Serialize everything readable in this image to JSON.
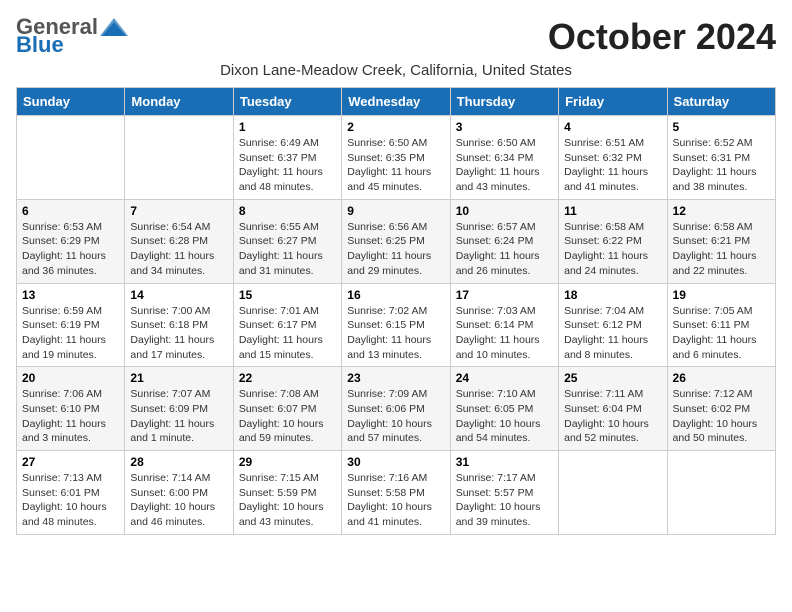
{
  "logo": {
    "general": "General",
    "blue": "Blue"
  },
  "title": "October 2024",
  "subtitle": "Dixon Lane-Meadow Creek, California, United States",
  "days_of_week": [
    "Sunday",
    "Monday",
    "Tuesday",
    "Wednesday",
    "Thursday",
    "Friday",
    "Saturday"
  ],
  "weeks": [
    [
      {
        "day": "",
        "info": ""
      },
      {
        "day": "",
        "info": ""
      },
      {
        "day": "1",
        "info": "Sunrise: 6:49 AM\nSunset: 6:37 PM\nDaylight: 11 hours\nand 48 minutes."
      },
      {
        "day": "2",
        "info": "Sunrise: 6:50 AM\nSunset: 6:35 PM\nDaylight: 11 hours\nand 45 minutes."
      },
      {
        "day": "3",
        "info": "Sunrise: 6:50 AM\nSunset: 6:34 PM\nDaylight: 11 hours\nand 43 minutes."
      },
      {
        "day": "4",
        "info": "Sunrise: 6:51 AM\nSunset: 6:32 PM\nDaylight: 11 hours\nand 41 minutes."
      },
      {
        "day": "5",
        "info": "Sunrise: 6:52 AM\nSunset: 6:31 PM\nDaylight: 11 hours\nand 38 minutes."
      }
    ],
    [
      {
        "day": "6",
        "info": "Sunrise: 6:53 AM\nSunset: 6:29 PM\nDaylight: 11 hours\nand 36 minutes."
      },
      {
        "day": "7",
        "info": "Sunrise: 6:54 AM\nSunset: 6:28 PM\nDaylight: 11 hours\nand 34 minutes."
      },
      {
        "day": "8",
        "info": "Sunrise: 6:55 AM\nSunset: 6:27 PM\nDaylight: 11 hours\nand 31 minutes."
      },
      {
        "day": "9",
        "info": "Sunrise: 6:56 AM\nSunset: 6:25 PM\nDaylight: 11 hours\nand 29 minutes."
      },
      {
        "day": "10",
        "info": "Sunrise: 6:57 AM\nSunset: 6:24 PM\nDaylight: 11 hours\nand 26 minutes."
      },
      {
        "day": "11",
        "info": "Sunrise: 6:58 AM\nSunset: 6:22 PM\nDaylight: 11 hours\nand 24 minutes."
      },
      {
        "day": "12",
        "info": "Sunrise: 6:58 AM\nSunset: 6:21 PM\nDaylight: 11 hours\nand 22 minutes."
      }
    ],
    [
      {
        "day": "13",
        "info": "Sunrise: 6:59 AM\nSunset: 6:19 PM\nDaylight: 11 hours\nand 19 minutes."
      },
      {
        "day": "14",
        "info": "Sunrise: 7:00 AM\nSunset: 6:18 PM\nDaylight: 11 hours\nand 17 minutes."
      },
      {
        "day": "15",
        "info": "Sunrise: 7:01 AM\nSunset: 6:17 PM\nDaylight: 11 hours\nand 15 minutes."
      },
      {
        "day": "16",
        "info": "Sunrise: 7:02 AM\nSunset: 6:15 PM\nDaylight: 11 hours\nand 13 minutes."
      },
      {
        "day": "17",
        "info": "Sunrise: 7:03 AM\nSunset: 6:14 PM\nDaylight: 11 hours\nand 10 minutes."
      },
      {
        "day": "18",
        "info": "Sunrise: 7:04 AM\nSunset: 6:12 PM\nDaylight: 11 hours\nand 8 minutes."
      },
      {
        "day": "19",
        "info": "Sunrise: 7:05 AM\nSunset: 6:11 PM\nDaylight: 11 hours\nand 6 minutes."
      }
    ],
    [
      {
        "day": "20",
        "info": "Sunrise: 7:06 AM\nSunset: 6:10 PM\nDaylight: 11 hours\nand 3 minutes."
      },
      {
        "day": "21",
        "info": "Sunrise: 7:07 AM\nSunset: 6:09 PM\nDaylight: 11 hours\nand 1 minute."
      },
      {
        "day": "22",
        "info": "Sunrise: 7:08 AM\nSunset: 6:07 PM\nDaylight: 10 hours\nand 59 minutes."
      },
      {
        "day": "23",
        "info": "Sunrise: 7:09 AM\nSunset: 6:06 PM\nDaylight: 10 hours\nand 57 minutes."
      },
      {
        "day": "24",
        "info": "Sunrise: 7:10 AM\nSunset: 6:05 PM\nDaylight: 10 hours\nand 54 minutes."
      },
      {
        "day": "25",
        "info": "Sunrise: 7:11 AM\nSunset: 6:04 PM\nDaylight: 10 hours\nand 52 minutes."
      },
      {
        "day": "26",
        "info": "Sunrise: 7:12 AM\nSunset: 6:02 PM\nDaylight: 10 hours\nand 50 minutes."
      }
    ],
    [
      {
        "day": "27",
        "info": "Sunrise: 7:13 AM\nSunset: 6:01 PM\nDaylight: 10 hours\nand 48 minutes."
      },
      {
        "day": "28",
        "info": "Sunrise: 7:14 AM\nSunset: 6:00 PM\nDaylight: 10 hours\nand 46 minutes."
      },
      {
        "day": "29",
        "info": "Sunrise: 7:15 AM\nSunset: 5:59 PM\nDaylight: 10 hours\nand 43 minutes."
      },
      {
        "day": "30",
        "info": "Sunrise: 7:16 AM\nSunset: 5:58 PM\nDaylight: 10 hours\nand 41 minutes."
      },
      {
        "day": "31",
        "info": "Sunrise: 7:17 AM\nSunset: 5:57 PM\nDaylight: 10 hours\nand 39 minutes."
      },
      {
        "day": "",
        "info": ""
      },
      {
        "day": "",
        "info": ""
      }
    ]
  ]
}
